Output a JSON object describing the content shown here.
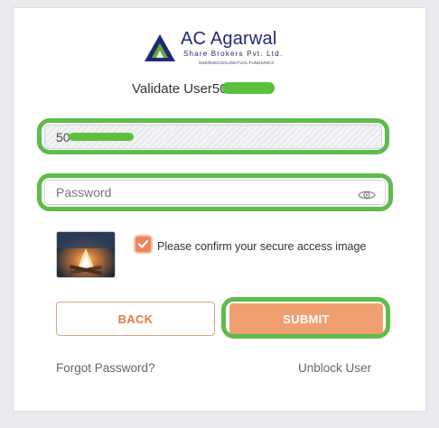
{
  "brand": {
    "name": "AC Agarwal",
    "tagline": "Share Brokers Pvt. Ltd.",
    "subtitle": "NSE/BSE/CDSL/MUTUAL FUNDS/MCX"
  },
  "page": {
    "title_prefix": "Validate User50"
  },
  "user_field": {
    "value_prefix": "50"
  },
  "password_field": {
    "placeholder": "Password"
  },
  "confirm": {
    "checked": true,
    "label": "Please confirm your secure access image"
  },
  "buttons": {
    "back": "BACK",
    "submit": "SUBMIT"
  },
  "links": {
    "forgot": "Forgot Password?",
    "unblock": "Unblock User"
  },
  "colors": {
    "brand_navy": "#1d2a74",
    "accent_orange": "#ef9f70",
    "highlight_green": "#5fbb4c"
  },
  "icons": {
    "password_toggle": "eye-icon",
    "checkbox": "checkmark-icon"
  }
}
